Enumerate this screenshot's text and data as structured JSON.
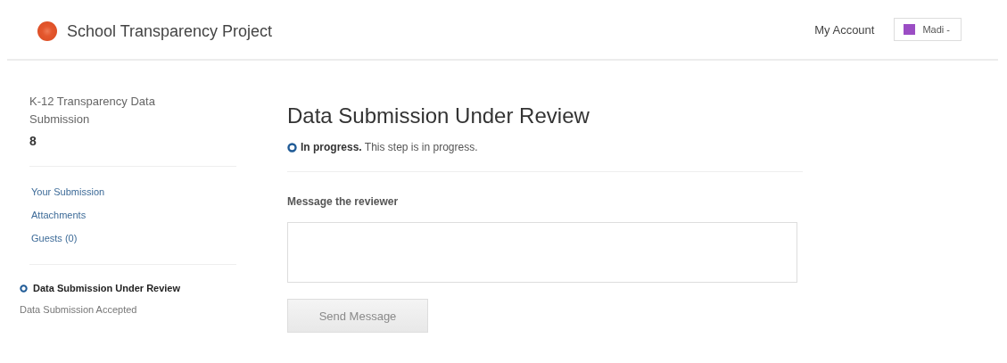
{
  "header": {
    "site_title": "School Transparency Project",
    "account_link": "My Account",
    "user_menu": {
      "label": "Madi -"
    }
  },
  "sidebar": {
    "title": "K-12 Transparency Data Submission",
    "number": "8",
    "links": [
      {
        "label": "Your Submission"
      },
      {
        "label": "Attachments"
      },
      {
        "label": "Guests (0)"
      }
    ],
    "steps": [
      {
        "label": "Data Submission Under Review",
        "current": true
      },
      {
        "label": "Data Submission Accepted",
        "current": false
      }
    ]
  },
  "main": {
    "heading": "Data Submission Under Review",
    "status": "**In progress.** This step is in progress.",
    "message_label": "Message the reviewer",
    "send_button": {
      "label": "Send Message",
      "disabled": true
    }
  }
}
